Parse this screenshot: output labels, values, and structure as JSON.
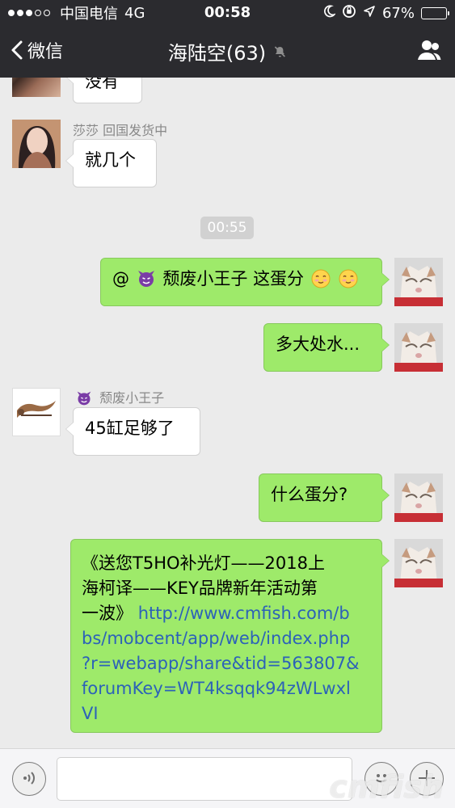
{
  "status_bar": {
    "carrier": "中国电信",
    "network": "4G",
    "time": "00:58",
    "battery_percent": "67%",
    "battery_level": 0.67,
    "signal_strength": 3,
    "signal_max": 5
  },
  "nav": {
    "back_label": "微信",
    "title": "海陆空(63)"
  },
  "messages": [
    {
      "side": "left",
      "text": "没有"
    },
    {
      "side": "left",
      "sender": "莎莎 回国发货中",
      "text": "就几个"
    },
    {
      "timestamp": "00:55"
    },
    {
      "side": "right",
      "prefix": "@",
      "mention": "颓废小王子",
      "text": "这蛋分"
    },
    {
      "side": "right",
      "text": "多大处水..."
    },
    {
      "side": "left",
      "sender": "颓废小王子",
      "text": "45缸足够了"
    },
    {
      "side": "right",
      "text": "什么蛋分?"
    },
    {
      "side": "right",
      "text_lines": [
        "《送您T5HO补光灯——2018上",
        "海柯译——KEY品牌新年活动第",
        "一波》 "
      ],
      "link_lines": [
        "http://www.cmfish.com/b",
        "bs/mobcent/app/web/index.php",
        "?r=webapp/share&tid=563807&",
        "forumKey=WT4ksqqk94zWLwxl",
        "VI"
      ]
    }
  ],
  "input_bar": {
    "message_placeholder": ""
  },
  "watermark": "cmfish",
  "icons": [
    "chevron-left-icon",
    "mute-bell-icon",
    "group-contacts-icon",
    "voice-icon",
    "emoji-icon",
    "plus-icon"
  ],
  "colors": {
    "nav_background": "#2b2b2f",
    "chat_background": "#ebebeb",
    "outgoing_bubble": "#9eea6a",
    "link": "#2c62b8"
  }
}
